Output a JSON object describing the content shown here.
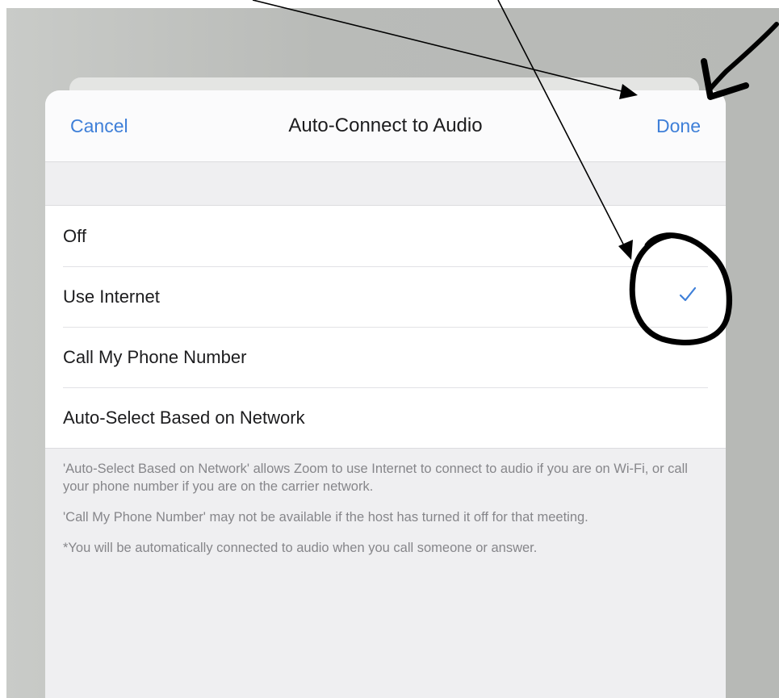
{
  "modal": {
    "title": "Auto-Connect to Audio",
    "cancel_label": "Cancel",
    "done_label": "Done"
  },
  "options": [
    {
      "label": "Off",
      "selected": false
    },
    {
      "label": "Use Internet",
      "selected": true
    },
    {
      "label": "Call My Phone Number",
      "selected": false
    },
    {
      "label": "Auto-Select Based on Network",
      "selected": false
    }
  ],
  "footer": {
    "note1": "'Auto-Select Based on Network' allows Zoom to use Internet to connect to audio if you are on Wi-Fi, or call your phone number if you are on the carrier network.",
    "note2": "'Call My Phone Number' may not be available if the host has turned it off for that meeting.",
    "note3": "*You will be automatically connected to audio when you call someone or answer."
  },
  "colors": {
    "accent": "#3e7fd8",
    "annotation": "#000000"
  },
  "icons": {
    "check": "checkmark-icon",
    "arrow": "arrow-icon"
  }
}
